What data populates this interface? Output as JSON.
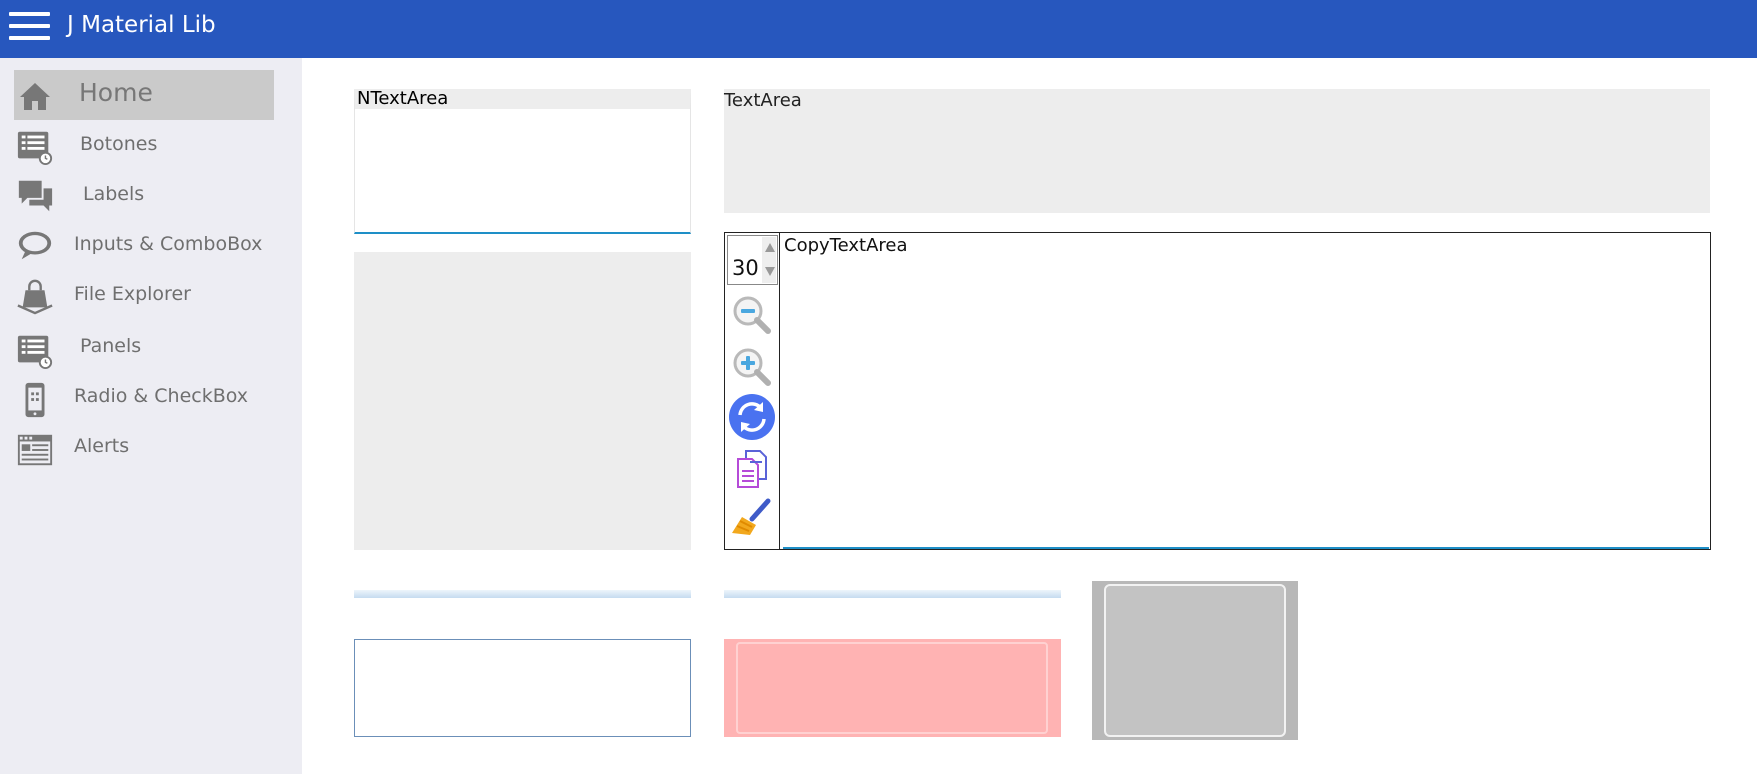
{
  "app": {
    "title": "J Material Lib",
    "brand_color": "#2757be"
  },
  "sidebar": {
    "items": [
      {
        "label": "Home",
        "icon": "home-icon",
        "active": true
      },
      {
        "label": "Botones",
        "icon": "list-clock-icon"
      },
      {
        "label": "Labels",
        "icon": "chat-bubbles-icon"
      },
      {
        "label": "Inputs & ComboBox",
        "icon": "speech-bubble-icon"
      },
      {
        "label": "File Explorer",
        "icon": "shopping-bag-icon"
      },
      {
        "label": "Panels",
        "icon": "list-clock-icon"
      },
      {
        "label": "Radio & CheckBox",
        "icon": "mobile-icon"
      },
      {
        "label": "Alerts",
        "icon": "browser-window-icon"
      }
    ]
  },
  "main": {
    "ntextarea_label": "NTextArea",
    "textarea_label": "TextArea",
    "copytextarea_label": "CopyTextArea",
    "spinner_value": "30",
    "toolbar": {
      "zoom_out": "zoom-out-icon",
      "zoom_in": "zoom-in-icon",
      "refresh": "refresh-icon",
      "copy": "copy-icon",
      "clear": "broom-icon"
    }
  }
}
